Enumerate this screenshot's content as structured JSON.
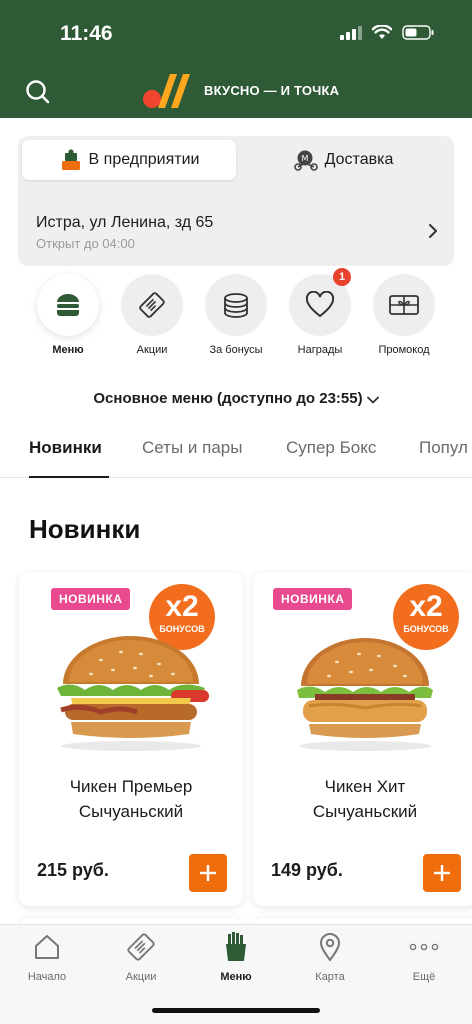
{
  "status_bar": {
    "time": "11:46"
  },
  "header": {
    "brand_name": "ВКУСНО — И ТОЧКА",
    "search_icon": "search-icon"
  },
  "mode_toggle": {
    "tabs": [
      {
        "label": "В предприятии",
        "icon": "restaurant-icon",
        "active": true
      },
      {
        "label": "Доставка",
        "icon": "delivery-scooter-icon",
        "active": false
      }
    ]
  },
  "restaurant": {
    "address": "Истра, ул Ленина, зд 65",
    "hours": "Открыт до 04:00"
  },
  "categories": [
    {
      "label": "Меню",
      "icon": "burger-icon",
      "active": true
    },
    {
      "label": "Акции",
      "icon": "coupon-icon",
      "active": false
    },
    {
      "label": "За бонусы",
      "icon": "coins-icon",
      "active": false
    },
    {
      "label": "Награды",
      "icon": "heart-icon",
      "active": false,
      "badge": "1"
    },
    {
      "label": "Промокод",
      "icon": "gift-card-icon",
      "active": false
    }
  ],
  "menu_selector": {
    "label": "Основное меню (доступно до 23:55)"
  },
  "tabs": [
    {
      "label": "Новинки",
      "active": true
    },
    {
      "label": "Сеты и пары",
      "active": false
    },
    {
      "label": "Супер Бокс",
      "active": false
    },
    {
      "label": "Попул",
      "active": false
    }
  ],
  "section_title": "Новинки",
  "products": [
    {
      "badge": "НОВИНКА",
      "bonus_multiplier": "x2",
      "bonus_label": "БОНУСОВ",
      "name_line1": "Чикен Премьер",
      "name_line2": "Сычуаньский",
      "price": "215 руб."
    },
    {
      "badge": "НОВИНКА",
      "bonus_multiplier": "x2",
      "bonus_label": "БОНУСОВ",
      "name_line1": "Чикен Хит",
      "name_line2": "Сычуаньский",
      "price": "149 руб."
    }
  ],
  "bottom_nav": [
    {
      "label": "Начало",
      "icon": "home-icon",
      "active": false
    },
    {
      "label": "Акции",
      "icon": "coupon-icon",
      "active": false
    },
    {
      "label": "Меню",
      "icon": "fries-icon",
      "active": true
    },
    {
      "label": "Карта",
      "icon": "map-pin-icon",
      "active": false
    },
    {
      "label": "Ещё",
      "icon": "more-icon",
      "active": false
    }
  ],
  "colors": {
    "header_green": "#2e5a36",
    "accent_orange": "#f06d0e",
    "new_badge_pink": "#e94a8f",
    "notification_red": "#e9422f"
  }
}
